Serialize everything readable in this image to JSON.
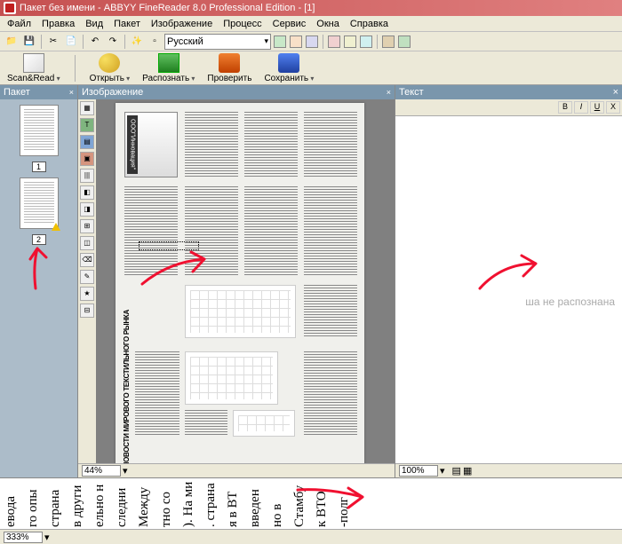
{
  "title": "Пакет без имени - ABBYY FineReader 8.0 Professional Edition - [1]",
  "menu": {
    "file": "Файл",
    "edit": "Правка",
    "view": "Вид",
    "batch": "Пакет",
    "image": "Изображение",
    "process": "Процесс",
    "service": "Сервис",
    "windows": "Окна",
    "help": "Справка"
  },
  "language": "Русский",
  "bigtoolbar": {
    "scan": "Scan&Read",
    "open": "Открыть",
    "recognize": "Распознать",
    "check": "Проверить",
    "save": "Сохранить"
  },
  "panels": {
    "batch": "Пакет",
    "image": "Изображение",
    "text": "Текст"
  },
  "pages": {
    "p1": "1",
    "p2": "2"
  },
  "doc": {
    "ad": "ООО\"Инновация\"",
    "headline": "НОВОСТИ МИРОВОГО ТЕКСТИЛЬНОГО РЫНКА"
  },
  "text_panel": {
    "msg": "ша не распознана"
  },
  "zoom": {
    "img": "44%",
    "text": "100%",
    "bottom": "333%"
  },
  "strip": [
    "евода",
    "го опы",
    "страна",
    "в други",
    "ельно н",
    "следни",
    "Между",
    "тно со",
    "). На ми",
    ". страна",
    "я в ВТ",
    "введен",
    "но в",
    "Стамбу",
    "к ВТО",
    "-полг"
  ],
  "icons": {
    "bold": "B",
    "italic": "I",
    "under": "U",
    "strike": "X"
  }
}
